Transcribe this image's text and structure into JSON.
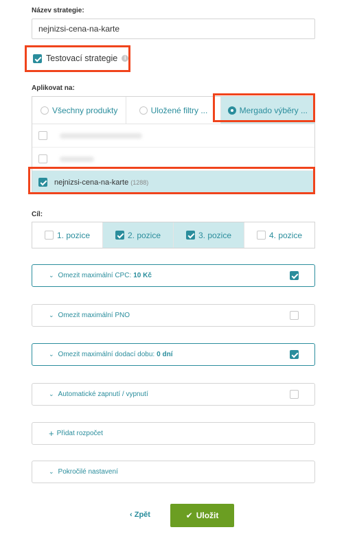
{
  "strategy_name": {
    "label": "Název strategie:",
    "value": "nejnizsi-cena-na-karte"
  },
  "test_strategy": {
    "label": "Testovací strategie",
    "checked": true,
    "info_icon": "info-icon"
  },
  "apply_to": {
    "label": "Aplikovat na:",
    "tabs": [
      {
        "label": "Všechny produkty",
        "selected": false
      },
      {
        "label": "Uložené filtry ...",
        "selected": false
      },
      {
        "label": "Mergado výběry ...",
        "selected": true
      }
    ],
    "selected_item": {
      "name": "nejnizsi-cena-na-karte",
      "count": "(1288)",
      "checked": true
    }
  },
  "goal": {
    "label": "Cíl:",
    "options": [
      {
        "label": "1. pozice",
        "checked": false
      },
      {
        "label": "2. pozice",
        "checked": true
      },
      {
        "label": "3. pozice",
        "checked": true
      },
      {
        "label": "4. pozice",
        "checked": false
      }
    ]
  },
  "panels": {
    "max_cpc": {
      "label": "Omezit maximální CPC:",
      "value": "10 Kč",
      "checked": true
    },
    "max_pno": {
      "label": "Omezit maximální PNO",
      "checked": false
    },
    "max_delivery": {
      "label": "Omezit maximální dodací dobu:",
      "value": "0 dní",
      "checked": true
    },
    "auto_toggle": {
      "label": "Automatické zapnutí / vypnutí",
      "checked": false
    },
    "add_budget": {
      "label": "Přidat rozpočet"
    },
    "advanced": {
      "label": "Pokročilé nastavení"
    }
  },
  "actions": {
    "back_label": "Zpět",
    "save_label": "Uložit"
  },
  "colors": {
    "accent": "#2a8d9c",
    "selected_bg": "#cce9ec",
    "save": "#6b9e22",
    "highlight": "#f0441c"
  }
}
